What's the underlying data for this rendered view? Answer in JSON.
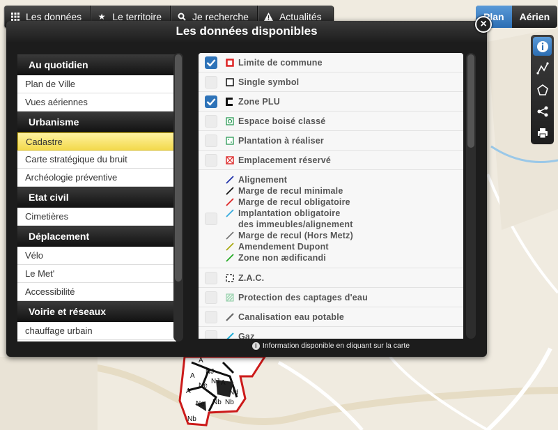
{
  "toolbar": {
    "items": [
      {
        "label": "Les données",
        "icon": "grid-icon"
      },
      {
        "label": "Le territoire",
        "icon": "star-icon"
      },
      {
        "label": "Je recherche",
        "icon": "search-icon"
      },
      {
        "label": "Actualités",
        "icon": "warning-icon"
      }
    ]
  },
  "basemap": {
    "plan": "Plan",
    "aerien": "Aérien",
    "active": "plan"
  },
  "panel": {
    "title": "Les données disponibles",
    "close": "×",
    "info_note": "Information disponible en cliquant sur la carte",
    "info_icon": "i"
  },
  "categories": [
    {
      "type": "head",
      "label": "Au quotidien"
    },
    {
      "type": "item",
      "label": "Plan de Ville"
    },
    {
      "type": "item",
      "label": "Vues aériennes"
    },
    {
      "type": "head",
      "label": "Urbanisme"
    },
    {
      "type": "item",
      "label": "Cadastre",
      "selected": true
    },
    {
      "type": "item",
      "label": "Carte stratégique du bruit"
    },
    {
      "type": "item",
      "label": "Archéologie préventive"
    },
    {
      "type": "head",
      "label": "Etat civil"
    },
    {
      "type": "item",
      "label": "Cimetières"
    },
    {
      "type": "head",
      "label": "Déplacement"
    },
    {
      "type": "item",
      "label": "Vélo"
    },
    {
      "type": "item",
      "label": "Le Met'"
    },
    {
      "type": "item",
      "label": "Accessibilité"
    },
    {
      "type": "head",
      "label": "Voirie et réseaux"
    },
    {
      "type": "item",
      "label": "chauffage urbain"
    }
  ],
  "layers": [
    {
      "label": "Limite de commune",
      "checked": true,
      "symbol": "red-square"
    },
    {
      "label": "Single symbol",
      "checked": false,
      "symbol": "black-square"
    },
    {
      "label": "Zone PLU",
      "checked": true,
      "symbol": "black-bracket"
    },
    {
      "label": "Espace boisé classé",
      "checked": false,
      "symbol": "green-circle-square"
    },
    {
      "label": "Plantation à réaliser",
      "checked": false,
      "symbol": "green-dotted-square"
    },
    {
      "label": "Emplacement réservé",
      "checked": false,
      "symbol": "red-hatched-square"
    },
    {
      "checked": false,
      "multi": [
        {
          "label": "Alignement",
          "color": "#2233aa"
        },
        {
          "label": "Marge de recul minimale",
          "color": "#111111"
        },
        {
          "label": "Marge de recul obligatoire",
          "color": "#dd2222"
        },
        {
          "label": "Implantation obligatoire",
          "color": "#33aadd",
          "label2": "des immeubles/alignement"
        },
        {
          "label": "Marge de recul (Hors Metz)",
          "color": "#777777"
        },
        {
          "label": "Amendement Dupont",
          "color": "#aaaa11"
        },
        {
          "label": "Zone non ædificandi",
          "color": "#22aa22"
        }
      ]
    },
    {
      "label": "Z.A.C.",
      "checked": false,
      "symbol": "dashed-square"
    },
    {
      "label": "Protection des captages d'eau",
      "checked": false,
      "symbol": "green-hatch-square"
    },
    {
      "label": "Canalisation eau potable",
      "checked": false,
      "symbol": "gray-line"
    },
    {
      "label": "Gaz",
      "checked": false,
      "symbol": "cyan-line"
    }
  ],
  "map_labels": [
    "A",
    "NJ",
    "A",
    "NJ",
    "A",
    "Ne",
    "A",
    "Nd",
    "Nb",
    "Ne",
    "Nb",
    "Nb"
  ],
  "colors": {
    "accent": "#2e73b8",
    "selected": "#f3d94c"
  }
}
